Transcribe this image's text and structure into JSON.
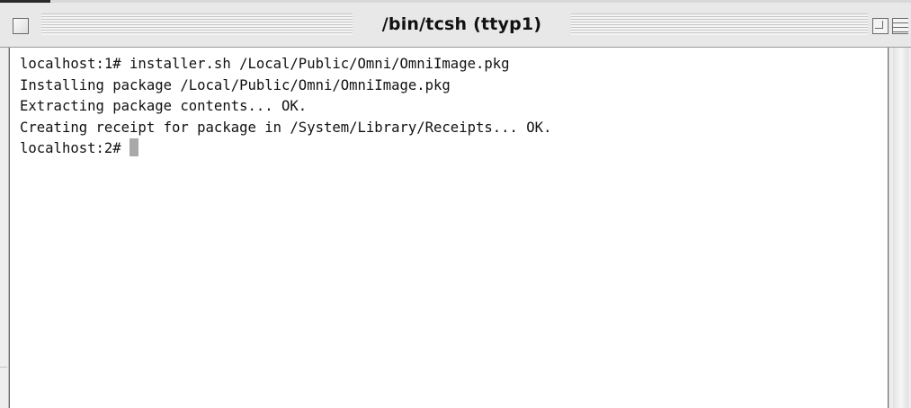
{
  "window": {
    "title": "/bin/tcsh (ttyp1)"
  },
  "terminal": {
    "lines": [
      "localhost:1# installer.sh /Local/Public/Omni/OmniImage.pkg",
      "Installing package /Local/Public/Omni/OmniImage.pkg",
      "Extracting package contents... OK.",
      "Creating receipt for package in /System/Library/Receipts... OK."
    ],
    "prompt": "localhost:2#"
  },
  "icons": {
    "close": "close-box-icon",
    "zoom": "zoom-box-icon",
    "collapse": "collapse-box-icon",
    "cursor": "text-cursor-block"
  },
  "colors": {
    "background": "#ffffff",
    "text": "#111111",
    "cursor": "#a9a9a9",
    "frame": "#e8e8e8"
  }
}
